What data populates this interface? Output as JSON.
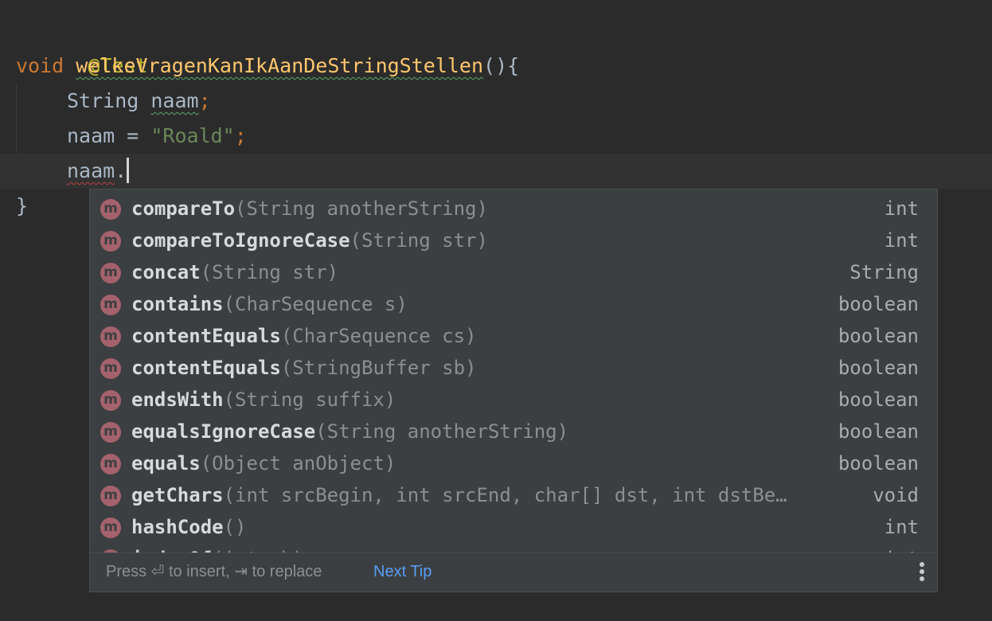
{
  "editor": {
    "line1": {
      "annotation": "@Test"
    },
    "line2": {
      "keyword": "void",
      "method": "welkeVragenKanIkAanDeStringStellen",
      "rest": "(){"
    },
    "line3": {
      "type": "String",
      "var": "naam",
      "semi": ";"
    },
    "line4": {
      "var": "naam",
      "op": " = ",
      "string": "\"Roald\"",
      "semi": ";"
    },
    "line5": {
      "var": "naam",
      "dot": "."
    },
    "line6": {
      "brace": "}"
    }
  },
  "completion": {
    "icon_letter": "m",
    "items": [
      {
        "name": "compareTo",
        "params": "(String anotherString)",
        "returns": "int"
      },
      {
        "name": "compareToIgnoreCase",
        "params": "(String str)",
        "returns": "int"
      },
      {
        "name": "concat",
        "params": "(String str)",
        "returns": "String"
      },
      {
        "name": "contains",
        "params": "(CharSequence s)",
        "returns": "boolean"
      },
      {
        "name": "contentEquals",
        "params": "(CharSequence cs)",
        "returns": "boolean"
      },
      {
        "name": "contentEquals",
        "params": "(StringBuffer sb)",
        "returns": "boolean"
      },
      {
        "name": "endsWith",
        "params": "(String suffix)",
        "returns": "boolean"
      },
      {
        "name": "equalsIgnoreCase",
        "params": "(String anotherString)",
        "returns": "boolean"
      },
      {
        "name": "equals",
        "params": "(Object anObject)",
        "returns": "boolean"
      },
      {
        "name": "getChars",
        "params": "(int srcBegin, int srcEnd, char[] dst, int dstBe…",
        "returns": "void"
      },
      {
        "name": "hashCode",
        "params": "()",
        "returns": "int"
      },
      {
        "name": "indexOf",
        "params": "(int ch)",
        "returns": "int"
      }
    ],
    "footer": {
      "hint": "Press ⏎ to insert, ⇥ to replace",
      "next_tip": "Next Tip"
    }
  },
  "colors": {
    "background": "#2b2b2b",
    "popup_background": "#3c3f41",
    "method_icon": "#a4626c",
    "link": "#589df6"
  }
}
